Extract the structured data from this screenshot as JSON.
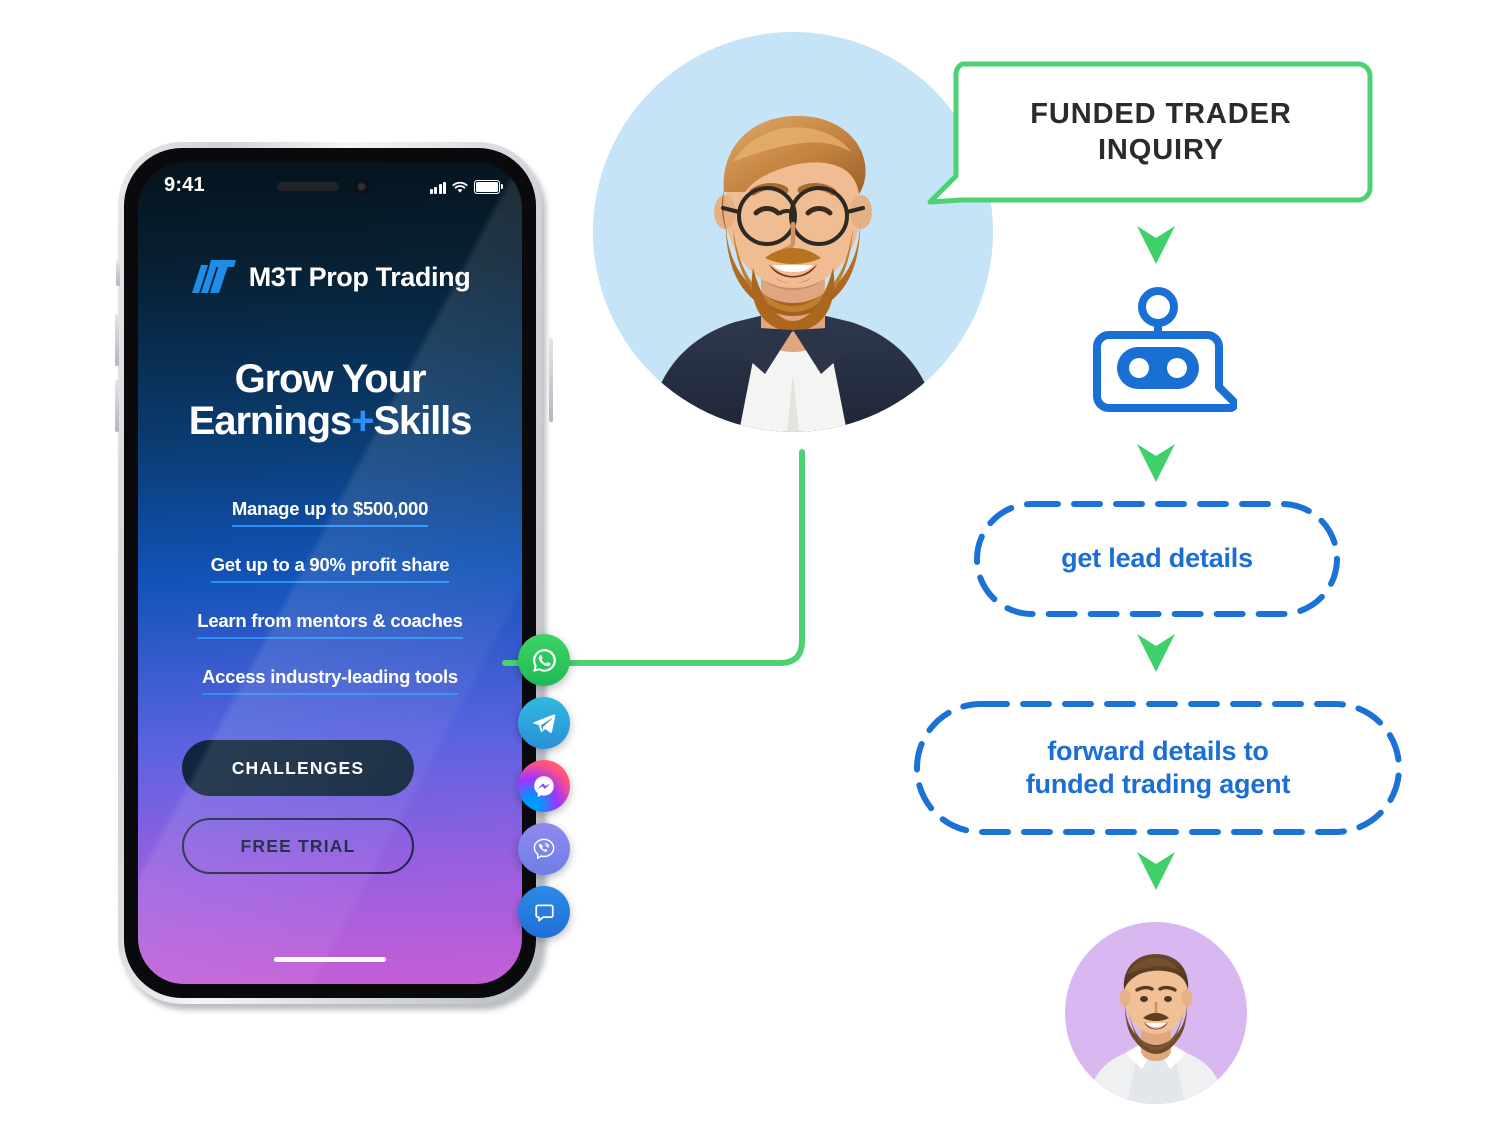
{
  "phone": {
    "status_bar": {
      "time": "9:41",
      "signal_icon": "cellular-signal-icon",
      "wifi_icon": "wifi-icon",
      "battery_icon": "battery-full-icon"
    },
    "brand": {
      "logo_icon": "m3t-logo-icon",
      "name": "M3T Prop Trading"
    },
    "headline": {
      "line1": "Grow Your",
      "line2_a": "Earnings",
      "line2_plus": "+",
      "line2_b": "Skills"
    },
    "features": [
      "Manage up to $500,000",
      "Get up to a 90% profit share",
      "Learn from mentors & coaches",
      "Access industry-leading tools"
    ],
    "cta": {
      "primary": "CHALLENGES",
      "secondary": "FREE TRIAL"
    },
    "social_channels": [
      {
        "name": "whatsapp",
        "icon": "whatsapp-icon"
      },
      {
        "name": "telegram",
        "icon": "telegram-icon"
      },
      {
        "name": "messenger",
        "icon": "messenger-icon"
      },
      {
        "name": "viber",
        "icon": "viber-icon"
      },
      {
        "name": "live-chat",
        "icon": "chat-bubble-icon"
      }
    ]
  },
  "flow": {
    "lead_avatar": {
      "icon": "lead-photo",
      "circle_color": "#c5e4f7"
    },
    "speech_bubble": {
      "line1": "FUNDED TRADER",
      "line2": "INQUIRY",
      "border_color": "#4cd273"
    },
    "bot": {
      "icon": "chatbot-icon",
      "color": "#1a6fd4"
    },
    "nodes": [
      {
        "id": "get-lead-details",
        "label": "get lead details"
      },
      {
        "id": "forward-details",
        "label": "forward details to\nfunded trading agent"
      }
    ],
    "node_line1": "forward details to",
    "node_line2": "funded trading agent",
    "agent_avatar": {
      "icon": "agent-photo",
      "circle_color": "#d9b8f2"
    },
    "arrow_icon": "arrow-down-icon",
    "arrow_color": "#3fd06a",
    "connector_color": "#4cd273",
    "node_border_color": "#1b72d6"
  }
}
